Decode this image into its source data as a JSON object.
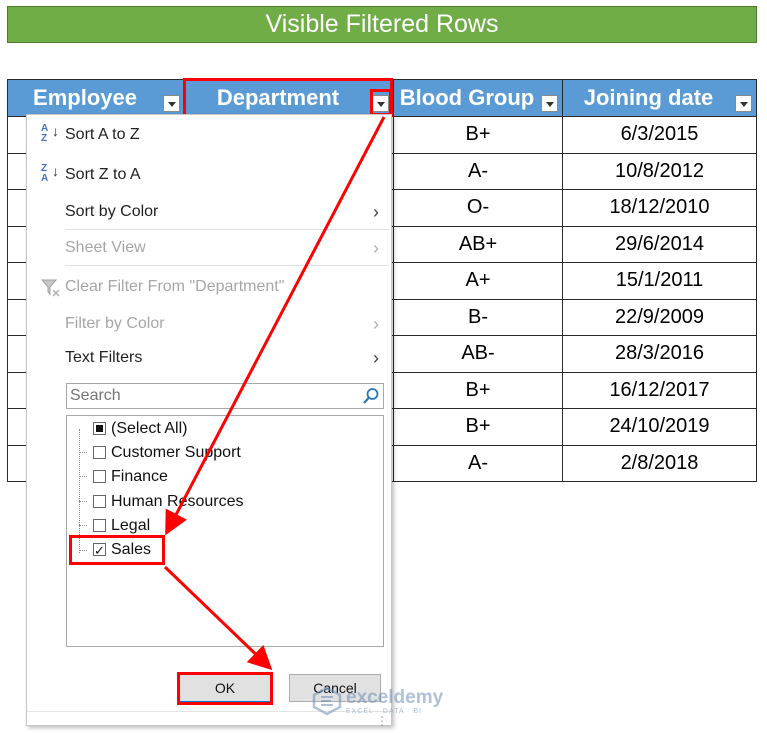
{
  "banner": {
    "title": "Visible Filtered Rows"
  },
  "table": {
    "headers": [
      "Employee",
      "Department",
      "Blood Group",
      "Joining date"
    ],
    "rows": [
      {
        "blood_group": "B+",
        "joining_date": "6/3/2015"
      },
      {
        "blood_group": "A-",
        "joining_date": "10/8/2012"
      },
      {
        "blood_group": "O-",
        "joining_date": "18/12/2010"
      },
      {
        "blood_group": "AB+",
        "joining_date": "29/6/2014"
      },
      {
        "blood_group": "A+",
        "joining_date": "15/1/2011"
      },
      {
        "blood_group": "B-",
        "joining_date": "22/9/2009"
      },
      {
        "blood_group": "AB-",
        "joining_date": "28/3/2016"
      },
      {
        "blood_group": "B+",
        "joining_date": "16/12/2017"
      },
      {
        "blood_group": "B+",
        "joining_date": "24/10/2019"
      },
      {
        "blood_group": "A-",
        "joining_date": "2/8/2018"
      }
    ]
  },
  "filter_menu": {
    "sort_az": "Sort A to Z",
    "sort_za": "Sort Z to A",
    "sort_by_color": "Sort by Color",
    "sheet_view": "Sheet View",
    "clear_filter": "Clear Filter From \"Department\"",
    "filter_by_color": "Filter by Color",
    "text_filters": "Text Filters",
    "search_placeholder": "Search",
    "items": [
      {
        "label": "(Select All)",
        "state": "partial"
      },
      {
        "label": "Customer Support",
        "state": "unchecked"
      },
      {
        "label": "Finance",
        "state": "unchecked"
      },
      {
        "label": "Human Resources",
        "state": "unchecked"
      },
      {
        "label": "Legal",
        "state": "unchecked"
      },
      {
        "label": "Sales",
        "state": "checked"
      }
    ],
    "ok_label": "OK",
    "cancel_label": "Cancel"
  },
  "watermark": {
    "brand": "exceldemy",
    "tagline": "EXCEL · DATA · BI"
  },
  "colors": {
    "banner": "#70ad47",
    "header": "#5b9bd5",
    "highlight": "#ff0000"
  }
}
